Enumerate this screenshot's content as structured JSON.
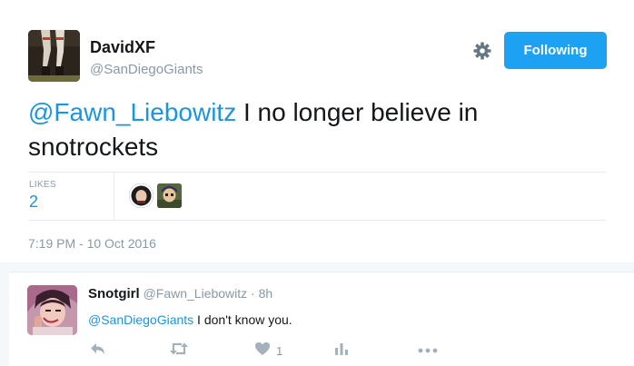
{
  "tweet": {
    "author": {
      "name": "DavidXF",
      "handle": "@SanDiegoGiants"
    },
    "follow_button_label": "Following",
    "text": {
      "mention": "@Fawn_Liebowitz",
      "body": " I no longer believe in snotrockets"
    },
    "stats": {
      "likes_label": "LIKES",
      "likes_count": "2"
    },
    "likers": [
      "liker-avatar-1",
      "liker-avatar-2"
    ],
    "timestamp": "7:19 PM - 10 Oct 2016"
  },
  "reply": {
    "name": "Snotgirl",
    "handle": "@Fawn_Liebowitz",
    "separator": " · ",
    "time": "8h",
    "mention": "@SanDiegoGiants",
    "body": " I don't know you.",
    "actions": {
      "like_count": "1"
    }
  },
  "icons": {
    "settings": "gear-icon",
    "reply": "reply-icon",
    "retweet": "retweet-icon",
    "like": "heart-icon",
    "analytics": "analytics-icon",
    "more": "more-icon"
  },
  "colors": {
    "accent": "#1da1f2",
    "link": "#1b95e0",
    "muted": "#8899a6",
    "divider": "#e6ecf0"
  }
}
